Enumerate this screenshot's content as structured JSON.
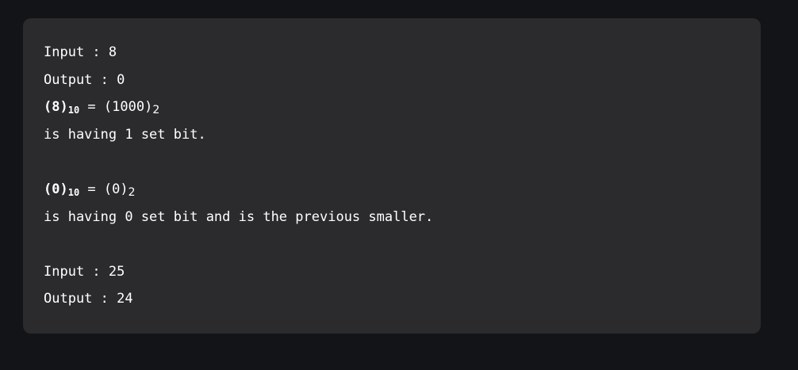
{
  "example1": {
    "input_line": "Input : 8",
    "output_line": "Output : 0",
    "conv1": {
      "dec_open": "(8)",
      "dec_sub": "10",
      "equals": " = ",
      "bin": "(1000)",
      "bin_sub": "2"
    },
    "desc1": "is having 1 set bit.",
    "conv2": {
      "dec_open": "(0)",
      "dec_sub": "10",
      "equals": " = ",
      "bin": "(0)",
      "bin_sub": "2"
    },
    "desc2": "is having 0 set bit and is the previous smaller."
  },
  "example2": {
    "input_line": "Input : 25",
    "output_line": "Output : 24"
  },
  "theme": {
    "page_background": "#131417",
    "block_background": "#2b2b2e",
    "text_color": "#ffffff"
  }
}
